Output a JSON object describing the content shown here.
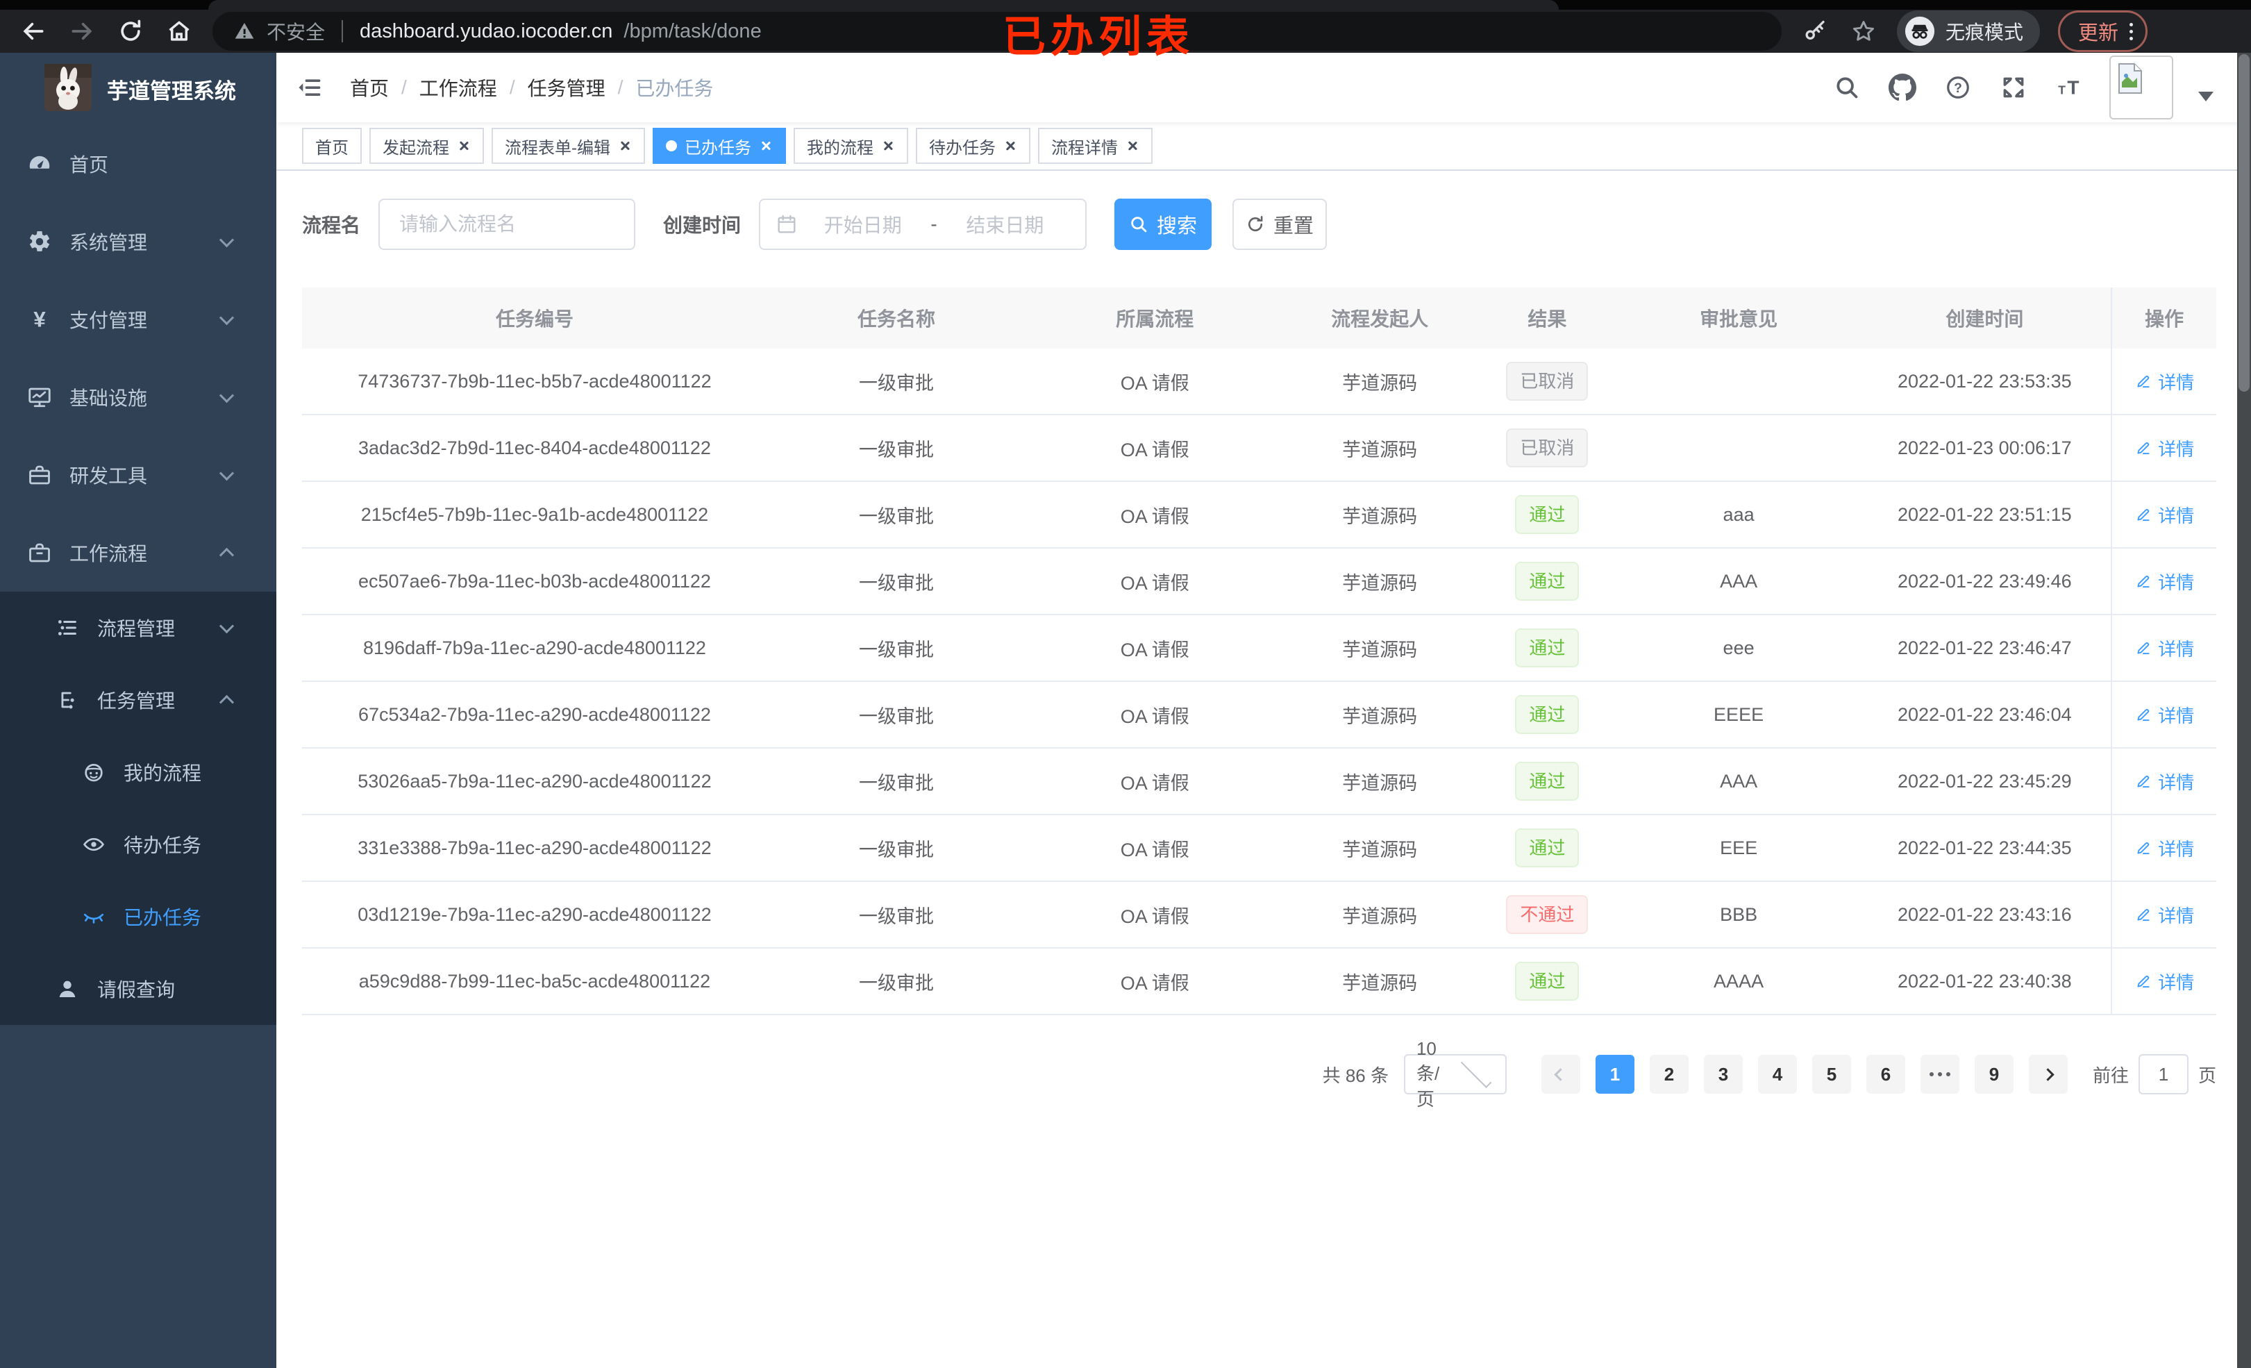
{
  "annotation": {
    "text": "已办列表"
  },
  "chrome": {
    "security_label": "不安全",
    "url_host": "dashboard.yudao.iocoder.cn",
    "url_path": "/bpm/task/done",
    "incognito_label": "无痕模式",
    "update_label": "更新"
  },
  "sidebar": {
    "title": "芋道管理系统",
    "menu": [
      {
        "label": "首页"
      },
      {
        "label": "系统管理"
      },
      {
        "label": "支付管理"
      },
      {
        "label": "基础设施"
      },
      {
        "label": "研发工具"
      },
      {
        "label": "工作流程"
      },
      {
        "label": "流程管理"
      },
      {
        "label": "任务管理"
      },
      {
        "label": "我的流程"
      },
      {
        "label": "待办任务"
      },
      {
        "label": "已办任务"
      },
      {
        "label": "请假查询"
      }
    ]
  },
  "navbar": {
    "breadcrumb": [
      "首页",
      "工作流程",
      "任务管理",
      "已办任务"
    ],
    "separator": "/"
  },
  "tabs": [
    {
      "label": "首页"
    },
    {
      "label": "发起流程"
    },
    {
      "label": "流程表单-编辑"
    },
    {
      "label": "已办任务"
    },
    {
      "label": "我的流程"
    },
    {
      "label": "待办任务"
    },
    {
      "label": "流程详情"
    }
  ],
  "filter": {
    "name_label": "流程名",
    "name_placeholder": "请输入流程名",
    "time_label": "创建时间",
    "start_placeholder": "开始日期",
    "separator": "-",
    "end_placeholder": "结束日期",
    "search_label": "搜索",
    "reset_label": "重置"
  },
  "table": {
    "headers": [
      "任务编号",
      "任务名称",
      "所属流程",
      "流程发起人",
      "结果",
      "审批意见",
      "创建时间",
      "操作"
    ],
    "detail_label": "详情",
    "rows": [
      {
        "id": "74736737-7b9b-11ec-b5b7-acde48001122",
        "name": "一级审批",
        "process": "OA 请假",
        "starter": "芋道源码",
        "result": "已取消",
        "result_type": "info",
        "comment": "",
        "time": "2022-01-22 23:53:35"
      },
      {
        "id": "3adac3d2-7b9d-11ec-8404-acde48001122",
        "name": "一级审批",
        "process": "OA 请假",
        "starter": "芋道源码",
        "result": "已取消",
        "result_type": "info",
        "comment": "",
        "time": "2022-01-23 00:06:17"
      },
      {
        "id": "215cf4e5-7b9b-11ec-9a1b-acde48001122",
        "name": "一级审批",
        "process": "OA 请假",
        "starter": "芋道源码",
        "result": "通过",
        "result_type": "success",
        "comment": "aaa",
        "time": "2022-01-22 23:51:15"
      },
      {
        "id": "ec507ae6-7b9a-11ec-b03b-acde48001122",
        "name": "一级审批",
        "process": "OA 请假",
        "starter": "芋道源码",
        "result": "通过",
        "result_type": "success",
        "comment": "AAA",
        "time": "2022-01-22 23:49:46"
      },
      {
        "id": "8196daff-7b9a-11ec-a290-acde48001122",
        "name": "一级审批",
        "process": "OA 请假",
        "starter": "芋道源码",
        "result": "通过",
        "result_type": "success",
        "comment": "eee",
        "time": "2022-01-22 23:46:47"
      },
      {
        "id": "67c534a2-7b9a-11ec-a290-acde48001122",
        "name": "一级审批",
        "process": "OA 请假",
        "starter": "芋道源码",
        "result": "通过",
        "result_type": "success",
        "comment": "EEEE",
        "time": "2022-01-22 23:46:04"
      },
      {
        "id": "53026aa5-7b9a-11ec-a290-acde48001122",
        "name": "一级审批",
        "process": "OA 请假",
        "starter": "芋道源码",
        "result": "通过",
        "result_type": "success",
        "comment": "AAA",
        "time": "2022-01-22 23:45:29"
      },
      {
        "id": "331e3388-7b9a-11ec-a290-acde48001122",
        "name": "一级审批",
        "process": "OA 请假",
        "starter": "芋道源码",
        "result": "通过",
        "result_type": "success",
        "comment": "EEE",
        "time": "2022-01-22 23:44:35"
      },
      {
        "id": "03d1219e-7b9a-11ec-a290-acde48001122",
        "name": "一级审批",
        "process": "OA 请假",
        "starter": "芋道源码",
        "result": "不通过",
        "result_type": "danger",
        "comment": "BBB",
        "time": "2022-01-22 23:43:16"
      },
      {
        "id": "a59c9d88-7b99-11ec-ba5c-acde48001122",
        "name": "一级审批",
        "process": "OA 请假",
        "starter": "芋道源码",
        "result": "通过",
        "result_type": "success",
        "comment": "AAAA",
        "time": "2022-01-22 23:40:38"
      }
    ]
  },
  "pagination": {
    "total": "共 86 条",
    "page_size": "10条/页",
    "pages": [
      "1",
      "2",
      "3",
      "4",
      "5",
      "6",
      "9"
    ],
    "goto_label": "前往",
    "goto_value": "1",
    "page_unit": "页"
  },
  "colors": {
    "primary": "#409eff",
    "success": "#67c23a",
    "danger": "#f56c6c",
    "info": "#909399",
    "sidebar": "#304156",
    "submenu": "#1f2d3d"
  }
}
